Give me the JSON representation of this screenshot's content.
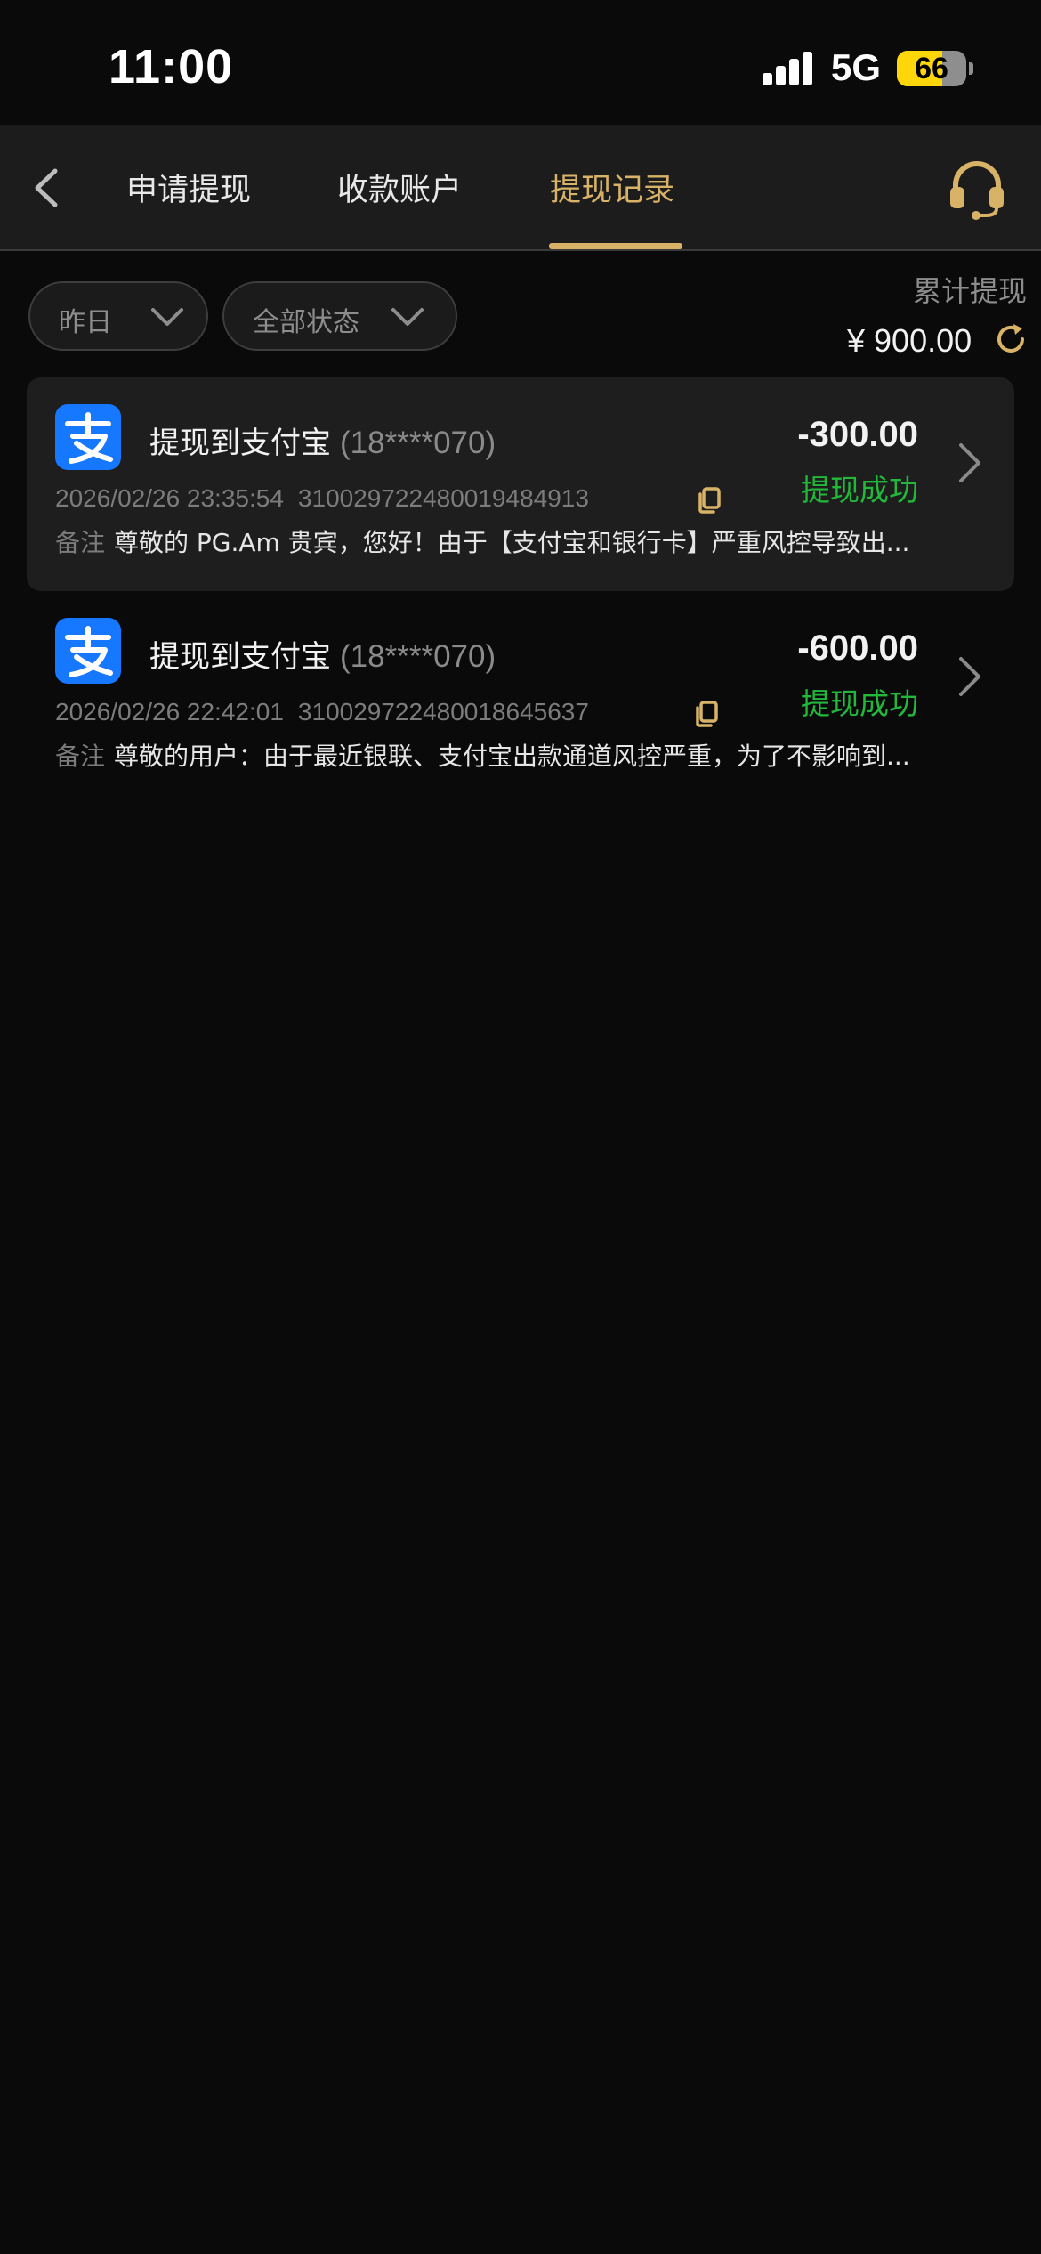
{
  "status_bar": {
    "time": "11:00",
    "network": "5G",
    "battery_level": 66,
    "battery_text": "66"
  },
  "nav": {
    "back_icon": "chevron-left-icon",
    "tabs": [
      {
        "label": "申请提现",
        "active": false
      },
      {
        "label": "收款账户",
        "active": false
      },
      {
        "label": "提现记录",
        "active": true
      }
    ],
    "support_icon": "headset-icon"
  },
  "filters": {
    "date": {
      "value": "昨日"
    },
    "status": {
      "value": "全部状态"
    }
  },
  "summary": {
    "label": "累计提现",
    "amount": "¥ 900.00",
    "refresh_icon": "refresh-icon"
  },
  "records": [
    {
      "title": "提现到支付宝",
      "account": "(18****070)",
      "datetime": "2026/02/26 23:35:54",
      "order_no": "310029722480019484913",
      "amount": "-300.00",
      "status": "提现成功",
      "remark_label": "备注",
      "remark": "尊敬的 PG.Am 贵宾，您好！由于【支付宝和银行卡】严重风控导致出..."
    },
    {
      "title": "提现到支付宝",
      "account": "(18****070)",
      "datetime": "2026/02/26 22:42:01",
      "order_no": "310029722480018645637",
      "amount": "-600.00",
      "status": "提现成功",
      "remark_label": "备注",
      "remark": "尊敬的用户：由于最近银联、支付宝出款通道风控严重，为了不影响到..."
    }
  ],
  "colors": {
    "background": "#0a0a0a",
    "accent": "#d8b367",
    "success": "#22b83a",
    "alipay_blue": "#1677ff"
  }
}
